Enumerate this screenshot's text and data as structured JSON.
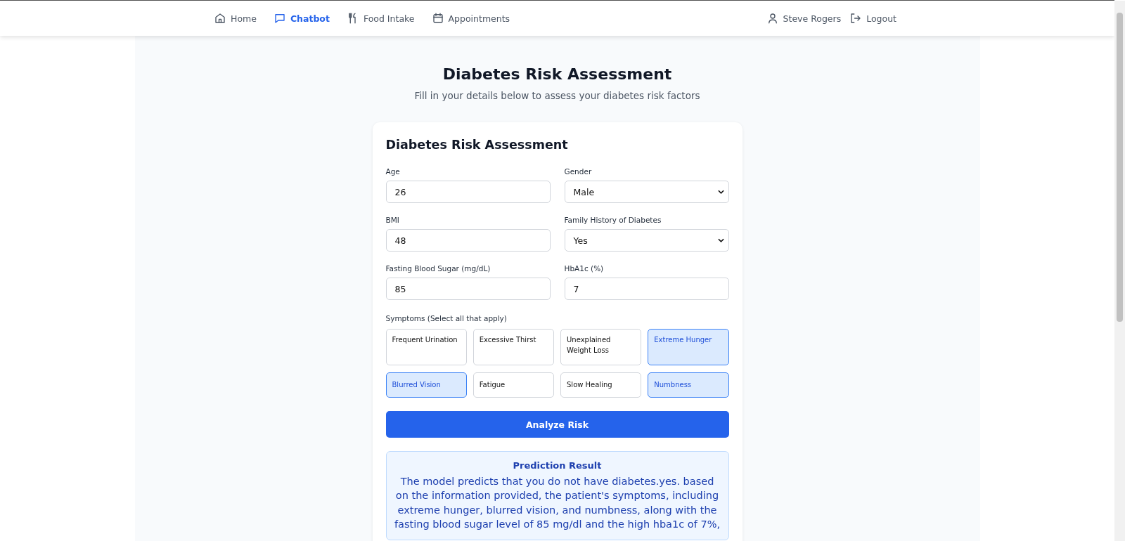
{
  "nav": {
    "items": [
      {
        "kind": "home",
        "label": "Home",
        "selected": false
      },
      {
        "kind": "chat",
        "label": "Chatbot",
        "selected": true
      },
      {
        "kind": "food",
        "label": "Food Intake",
        "selected": false
      },
      {
        "kind": "calendar",
        "label": "Appointments",
        "selected": false
      }
    ],
    "user": "Steve Rogers",
    "logout": "Logout"
  },
  "page": {
    "title": "Diabetes Risk Assessment",
    "subtitle": "Fill in your details below to assess your diabetes risk factors"
  },
  "form": {
    "title": "Diabetes Risk Assessment",
    "fields": [
      {
        "kind": "input",
        "label": "Age",
        "value": "26"
      },
      {
        "kind": "select",
        "label": "Gender",
        "value": "Male"
      },
      {
        "kind": "input",
        "label": "BMI",
        "value": "48"
      },
      {
        "kind": "select",
        "label": "Family History of Diabetes",
        "value": "Yes"
      },
      {
        "kind": "input",
        "label": "Fasting Blood Sugar (mg/dL)",
        "value": "85"
      },
      {
        "kind": "input",
        "label": "HbA1c (%)",
        "value": "7"
      }
    ],
    "symptoms_label": "Symptoms (Select all that apply)",
    "symptoms": [
      {
        "label": "Frequent Urination",
        "selected": false
      },
      {
        "label": "Excessive Thirst",
        "selected": false
      },
      {
        "label": "Unexplained Weight Loss",
        "selected": false
      },
      {
        "label": "Extreme Hunger",
        "selected": true
      },
      {
        "label": "Blurred Vision",
        "selected": true
      },
      {
        "label": "Fatigue",
        "selected": false
      },
      {
        "label": "Slow Healing",
        "selected": false
      },
      {
        "label": "Numbness",
        "selected": true
      }
    ],
    "submit": "Analyze Risk"
  },
  "result": {
    "title": "Prediction Result",
    "text": "The model predicts that you do not have diabetes.yes. based on the information provided, the patient's symptoms, including extreme hunger, blurred vision, and numbness, along with the fasting blood sugar level of 85 mg/dl and the high hba1c of 7%,"
  }
}
